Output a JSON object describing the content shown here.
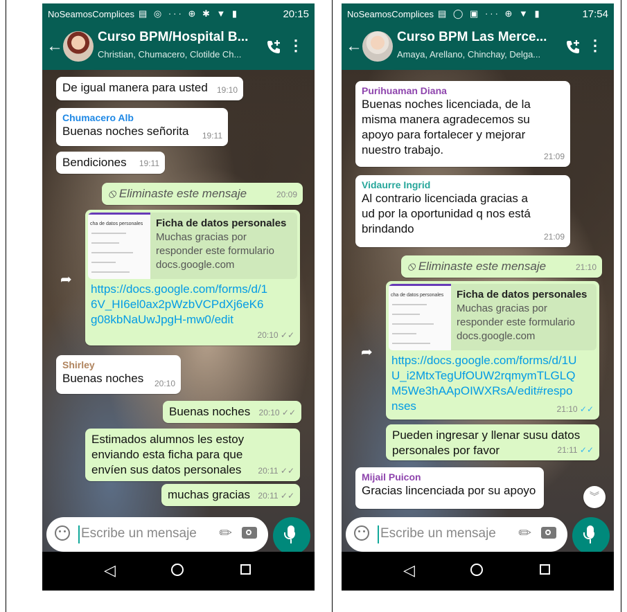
{
  "phones": [
    {
      "status": {
        "carrier": "NoSeamosComplices",
        "time": "20:15"
      },
      "header": {
        "title": "Curso BPM/Hospital B...",
        "subtitle": "Christian, Chumacero, Clotilde Ch..."
      },
      "messages": [
        {
          "text": "De igual manera para usted",
          "time": "19:10"
        },
        {
          "sender": "Chumacero Alb",
          "text": "Buenas noches señorita",
          "time": "19:11"
        },
        {
          "text": "Bendiciones",
          "time": "19:11"
        },
        {
          "text": "Eliminaste este mensaje",
          "time": "20:09"
        },
        {
          "preview_title": "Ficha de datos personales",
          "preview_desc": "Muchas gracias por responder este formulario",
          "preview_domain": "docs.google.com",
          "link": "https://docs.google.com/forms/d/16V_HI6el0ax2pWzbVCPdXj6eK6g08kbNaUwJpgH-mw0/edit",
          "time": "20:10"
        },
        {
          "sender": "Shirley",
          "text": "Buenas noches",
          "time": "20:10"
        },
        {
          "text": "Buenas noches",
          "time": "20:10"
        },
        {
          "text": "Estimados alumnos les estoy enviando esta ficha para que envíen sus datos personales",
          "time": "20:11"
        },
        {
          "text": "muchas gracias",
          "time": "20:11"
        }
      ],
      "composer": {
        "placeholder": "Escribe un mensaje"
      }
    },
    {
      "status": {
        "carrier": "NoSeamosComplices",
        "time": "17:54"
      },
      "header": {
        "title": "Curso BPM Las Merce...",
        "subtitle": "Amaya, Arellano, Chinchay, Delga..."
      },
      "messages": [
        {
          "sender": "Purihuaman Diana",
          "text": "Buenas noches licenciada, de la misma manera agradecemos su apoyo para fortalecer y mejorar nuestro trabajo.",
          "time": "21:09"
        },
        {
          "sender": "Vidaurre Ingrid",
          "text": "Al contrario licenciada gracias a ud por la oportunidad q nos está brindando",
          "time": "21:09"
        },
        {
          "text": "Eliminaste este mensaje",
          "time": "21:10"
        },
        {
          "preview_title": "Ficha de datos personales",
          "preview_desc": "Muchas gracias por responder este formulario",
          "preview_domain": "docs.google.com",
          "link": "https://docs.google.com/forms/d/1UU_i2MtxTegUfOUW2rqmymTLGLQM5We3hAApOIWXRsA/edit#responses",
          "time": "21:10"
        },
        {
          "text": "Pueden ingresar y llenar susu datos personales por favor",
          "time": "21:11"
        },
        {
          "sender": "Mijail Puicon",
          "text": "Gracias lincenciada por su apoyo",
          "time": ""
        }
      ],
      "composer": {
        "placeholder": "Escribe un mensaje"
      }
    }
  ],
  "form_thumb_title": "cha de datos personales",
  "colors": {
    "header": "#075e54",
    "outgoing": "#dcf8c6",
    "incoming": "#ffffff",
    "link": "#039be5",
    "mic": "#00897b"
  },
  "icons": [
    "back-arrow-icon",
    "add-call-icon",
    "more-vert-icon",
    "emoji-icon",
    "attach-icon",
    "camera-icon",
    "mic-icon",
    "forward-icon",
    "scroll-down-icon",
    "double-check-icon",
    "blocked-icon"
  ]
}
